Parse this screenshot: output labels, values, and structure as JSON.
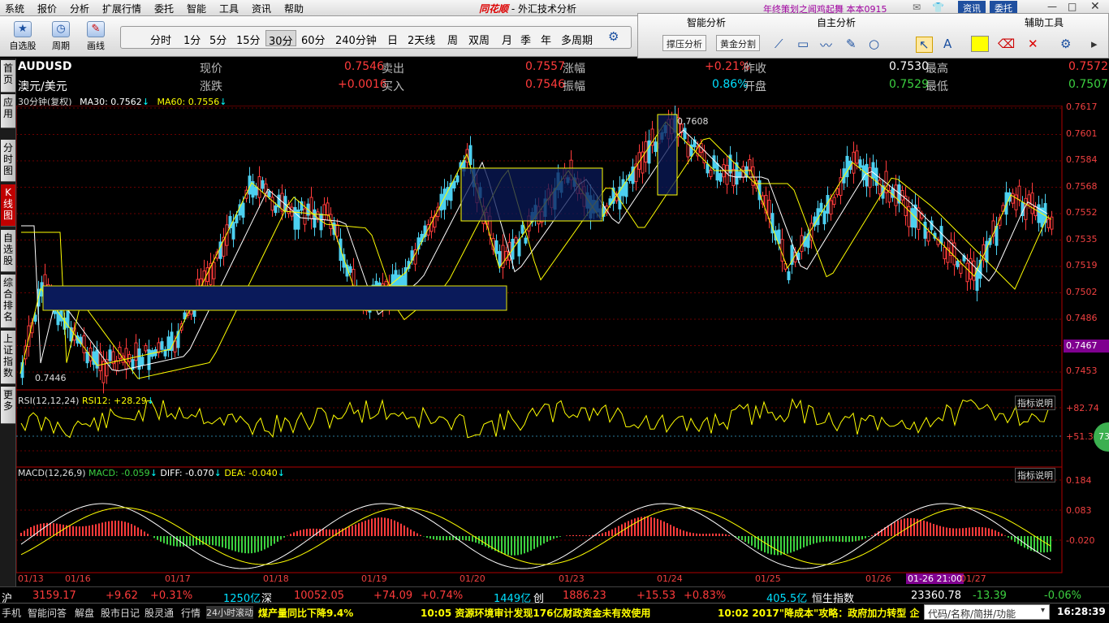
{
  "menu": {
    "items": [
      "系统",
      "报价",
      "分析",
      "扩展行情",
      "委托",
      "智能",
      "工具",
      "资讯",
      "帮助"
    ],
    "logo": "同花顺",
    "app_title": " - 外汇技术分析",
    "promo": "年终策划之闻鸡起舞  本本0915",
    "btn_news": "资讯",
    "btn_trade": "委托"
  },
  "toolbar": {
    "select_stock": "自选股",
    "period": "周期",
    "draw": "画线",
    "periods": [
      "分时",
      "1分",
      "5分",
      "15分",
      "30分",
      "60分",
      "240分钟",
      "日",
      "2天线",
      "周",
      "双周",
      "月",
      "季",
      "年",
      "多周期"
    ],
    "active_period": "30分"
  },
  "rightpanel": {
    "smart": "智能分析",
    "self": "自主分析",
    "aux": "辅助工具",
    "btn_support": "撑压分析",
    "btn_golden": "黄金分割"
  },
  "leftnav": [
    "首页",
    "应用",
    "分时图",
    "K线图",
    "自选股",
    "综合排名",
    "上证指数",
    "更多"
  ],
  "info": {
    "symbol": "AUDUSD",
    "name": "澳元/美元",
    "row1": [
      {
        "l": "现价",
        "v": "0.7546",
        "c": "#ff3b3b"
      },
      {
        "l": "卖出",
        "v": "0.7557",
        "c": "#ff3b3b"
      },
      {
        "l": "涨幅",
        "v": "+0.21%",
        "c": "#ff3b3b"
      },
      {
        "l": "昨收",
        "v": "0.7530",
        "c": "#ffffff"
      },
      {
        "l": "最高",
        "v": "0.7572",
        "c": "#ff3b3b"
      }
    ],
    "row2": [
      {
        "l": "涨跌",
        "v": "+0.0016",
        "c": "#ff3b3b"
      },
      {
        "l": "买入",
        "v": "0.7546",
        "c": "#ff3b3b"
      },
      {
        "l": "振幅",
        "v": "0.86%",
        "c": "#00e0ff"
      },
      {
        "l": "开盘",
        "v": "0.7529",
        "c": "#3cd040"
      },
      {
        "l": "最低",
        "v": "0.7507",
        "c": "#3cd040"
      }
    ]
  },
  "chart_main": {
    "period_label": "30分钟(复权)",
    "ma30": "MA30: 0.7562",
    "ma60": "MA60: 0.7556",
    "yticks": [
      "0.7617",
      "0.7601",
      "0.7584",
      "0.7568",
      "0.7552",
      "0.7535",
      "0.7519",
      "0.7502",
      "0.7486",
      "0.7467",
      "0.7453"
    ],
    "highlight_price": "0.7467",
    "hi_label": "0.7608",
    "lo_label": "0.7446"
  },
  "chart_rsi": {
    "label": "RSI(12,12,24)",
    "value": "RSI12: +28.29",
    "explain": "指标说明",
    "yticks": [
      "+82.74",
      "+51.30"
    ],
    "badge": "73"
  },
  "chart_macd": {
    "label": "MACD(12,26,9)",
    "macd": "MACD: -0.059",
    "diff": "DIFF: -0.070",
    "dea": "DEA: -0.040",
    "explain": "指标说明",
    "yticks": [
      "0.184",
      "0.083",
      "-0.020"
    ]
  },
  "dates": [
    "01/13",
    "01/16",
    "01/17",
    "01/18",
    "01/19",
    "01/20",
    "01/23",
    "01/24",
    "01/25",
    "01/26",
    "01-26 21:00",
    "01/27"
  ],
  "quotes": [
    {
      "name": "沪",
      "price": "3159.17",
      "chg": "+9.62",
      "pct": "+0.31%",
      "vol": "1250亿"
    },
    {
      "name": "深",
      "price": "10052.05",
      "chg": "+74.09",
      "pct": "+0.74%",
      "vol": "1449亿"
    },
    {
      "name": "创",
      "price": "1886.23",
      "chg": "+15.53",
      "pct": "+0.83%",
      "vol": "405.5亿"
    },
    {
      "name": "恒生指数",
      "price": "23360.78",
      "chg": "-13.39",
      "pct": "-0.06%",
      "vol": ""
    }
  ],
  "status": {
    "tabs": [
      "手机",
      "智能问答",
      "解盘",
      "股市日记",
      "股灵通",
      "行情",
      "24小时滚动"
    ],
    "news1": "煤产量同比下降9.4%",
    "news2": "10:05 资源环境审计发现176亿财政资金未有效使用",
    "news3": "10:02 2017\"降成本\"攻略：政府加力转型 企",
    "search_placeholder": "代码/名称/简拼/功能",
    "time": "16:28:39"
  },
  "colors": {
    "up": "#ff3b3b",
    "down": "#3cd040",
    "accent": "#ffff00",
    "bg": "#000000"
  }
}
